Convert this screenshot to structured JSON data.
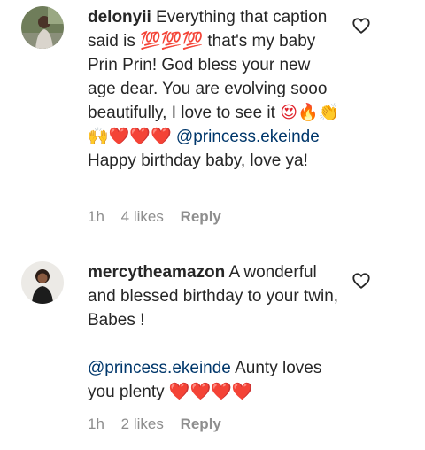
{
  "comments": [
    {
      "username": "delonyii",
      "text_1": "Everything that caption said is",
      "emoji_1": "💯💯💯",
      "text_2": "that's my baby Prin Prin! God bless your new age dear. You are evolving sooo beautifully, I love to see it",
      "emoji_2": "😍🔥👏🙌❤️❤️❤️",
      "mention": "@princess.ekeinde",
      "text_3": "Happy birthday baby, love ya!",
      "time": "1h",
      "likes": "4 likes",
      "reply": "Reply"
    },
    {
      "username": "mercytheamazon",
      "text_1": "A wonderful and blessed birthday to your twin, Babes !",
      "mention": "@princess.ekeinde",
      "text_2": "Aunty loves you plenty",
      "emoji_1": "❤️❤️❤️❤️",
      "time": "1h",
      "likes": "2 likes",
      "reply": "Reply"
    }
  ]
}
